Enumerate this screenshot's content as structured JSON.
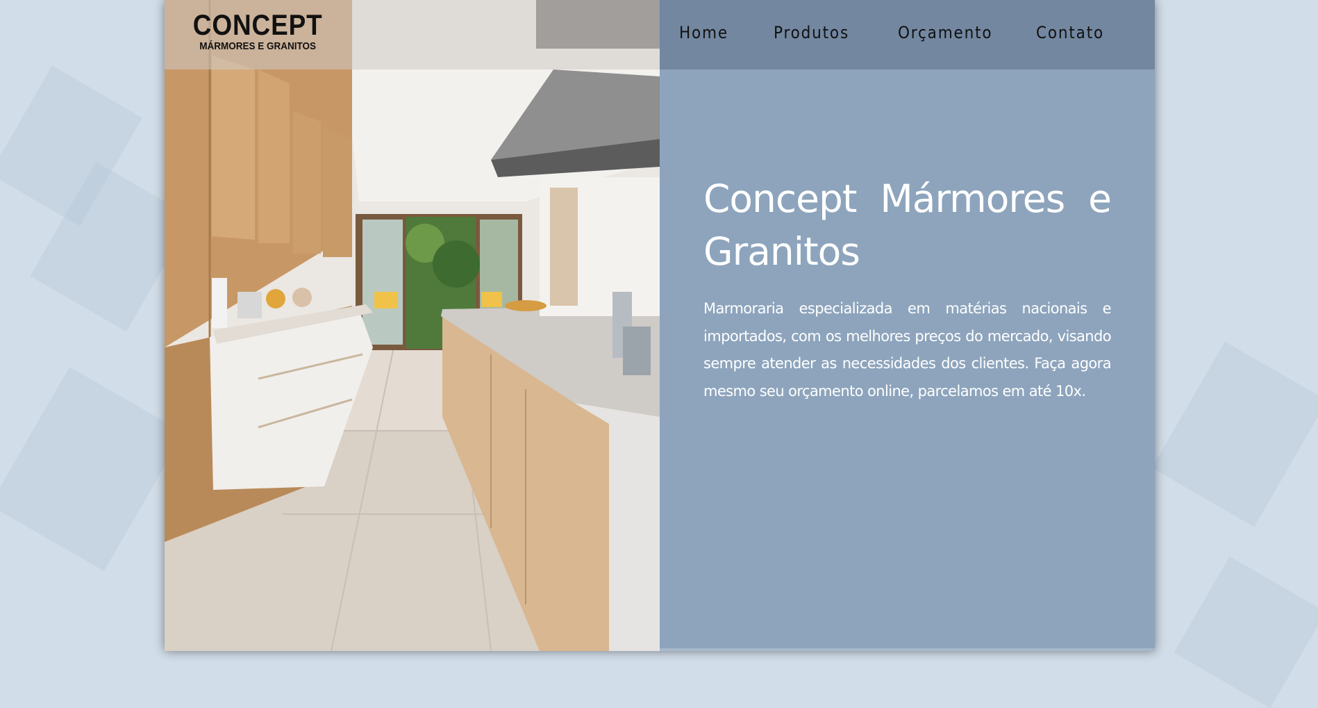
{
  "brand": {
    "name": "CONCEPT",
    "tagline": "MÁRMORES E GRANITOS"
  },
  "nav": {
    "items": [
      {
        "label": "Home"
      },
      {
        "label": "Produtos"
      },
      {
        "label": "Orçamento"
      },
      {
        "label": "Contato"
      }
    ]
  },
  "hero": {
    "title": "Concept Mármores e Granitos",
    "description": "Marmoraria especializada em matérias nacionais e importados, com os melhores preços do mercado, visando sempre atender as necessidades dos clientes. Faça agora mesmo seu orçamento online, parcelamos em até 10x."
  },
  "colors": {
    "background": "#d1dde8",
    "right_panel": "#8da4bc",
    "nav_bar": "#7387a0",
    "text_light": "#ffffff",
    "text_dark": "#111111"
  }
}
